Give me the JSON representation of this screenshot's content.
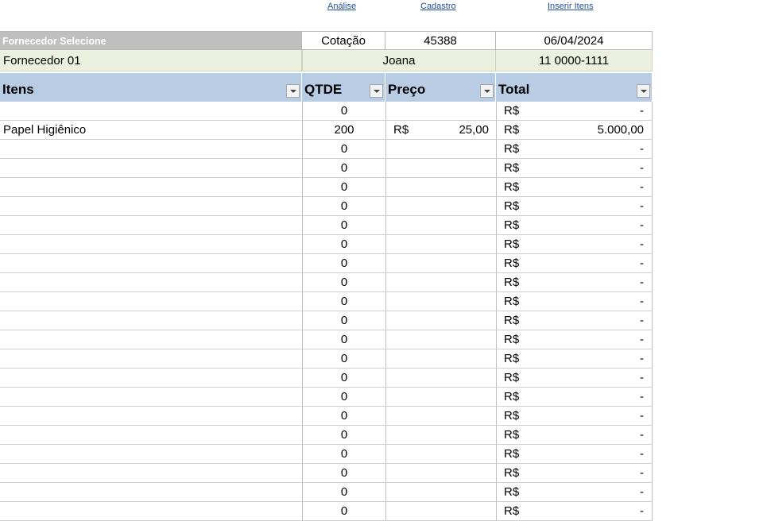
{
  "links": {
    "analise": "Análise",
    "cadastro": "Cadastro",
    "inserir": "Inserir Itens"
  },
  "header": {
    "supplier_select_label": "Fornecedor Selecione",
    "cotacao_label": "Cotação",
    "cotacao_number": "45388",
    "date": "06/04/2024",
    "supplier_name": "Fornecedor 01",
    "contact": "Joana",
    "phone": "11 0000-1111"
  },
  "columns": {
    "itens": "Itens",
    "qtde": "QTDE",
    "preco": "Preço",
    "total": "Total"
  },
  "currency": "R$",
  "rows": [
    {
      "item": "",
      "qtde": "0",
      "preco": "",
      "total": "-"
    },
    {
      "item": "Papel Higiênico",
      "qtde": "200",
      "preco": "25,00",
      "total": "5.000,00"
    },
    {
      "item": "",
      "qtde": "0",
      "preco": "",
      "total": "-"
    },
    {
      "item": "",
      "qtde": "0",
      "preco": "",
      "total": "-"
    },
    {
      "item": "",
      "qtde": "0",
      "preco": "",
      "total": "-"
    },
    {
      "item": "",
      "qtde": "0",
      "preco": "",
      "total": "-"
    },
    {
      "item": "",
      "qtde": "0",
      "preco": "",
      "total": "-"
    },
    {
      "item": "",
      "qtde": "0",
      "preco": "",
      "total": "-"
    },
    {
      "item": "",
      "qtde": "0",
      "preco": "",
      "total": "-"
    },
    {
      "item": "",
      "qtde": "0",
      "preco": "",
      "total": "-"
    },
    {
      "item": "",
      "qtde": "0",
      "preco": "",
      "total": "-"
    },
    {
      "item": "",
      "qtde": "0",
      "preco": "",
      "total": "-"
    },
    {
      "item": "",
      "qtde": "0",
      "preco": "",
      "total": "-"
    },
    {
      "item": "",
      "qtde": "0",
      "preco": "",
      "total": "-"
    },
    {
      "item": "",
      "qtde": "0",
      "preco": "",
      "total": "-"
    },
    {
      "item": "",
      "qtde": "0",
      "preco": "",
      "total": "-"
    },
    {
      "item": "",
      "qtde": "0",
      "preco": "",
      "total": "-"
    },
    {
      "item": "",
      "qtde": "0",
      "preco": "",
      "total": "-"
    },
    {
      "item": "",
      "qtde": "0",
      "preco": "",
      "total": "-"
    },
    {
      "item": "",
      "qtde": "0",
      "preco": "",
      "total": "-"
    },
    {
      "item": "",
      "qtde": "0",
      "preco": "",
      "total": "-"
    },
    {
      "item": "",
      "qtde": "0",
      "preco": "",
      "total": "-"
    }
  ]
}
